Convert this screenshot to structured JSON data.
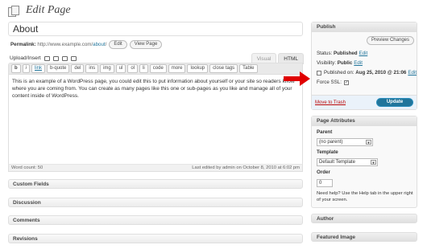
{
  "header": {
    "title": "Edit Page"
  },
  "title_field": {
    "value": "About"
  },
  "permalink": {
    "label": "Permalink:",
    "base": "http://www.example.com/",
    "slug": "about",
    "suffix": "/",
    "edit_label": "Edit",
    "view_label": "View Page"
  },
  "editor": {
    "upload_label": "Upload/Insert",
    "tabs": [
      {
        "label": "Visual"
      },
      {
        "label": "HTML"
      }
    ],
    "buttons": [
      "b",
      "i",
      "link",
      "b-quote",
      "del",
      "ins",
      "img",
      "ul",
      "ol",
      "li",
      "code",
      "more",
      "lookup",
      "close tags",
      "Table"
    ],
    "content": "This is an example of a WordPress page, you could edit this to put information about yourself or your site so readers know where you are coming from. You can create as many pages like this one or sub-pages as you like and manage all of your content inside of WordPress.",
    "word_count": "Word count: 50",
    "last_edited": "Last edited by admin on October 8, 2010 at 6:02 pm"
  },
  "boxes": {
    "custom_fields": "Custom Fields",
    "discussion": "Discussion",
    "comments": "Comments",
    "revisions": "Revisions"
  },
  "publish": {
    "title": "Publish",
    "preview_label": "Preview Changes",
    "status_label": "Status:",
    "status_value": "Published",
    "visibility_label": "Visibility:",
    "visibility_value": "Public",
    "published_label": "Published on:",
    "published_value": "Aug 25, 2010 @ 21:06",
    "edit_label": "Edit",
    "force_ssl_label": "Force SSL:",
    "force_ssl_mark": "✓",
    "trash_label": "Move to Trash",
    "update_label": "Update"
  },
  "attributes": {
    "title": "Page Attributes",
    "parent_label": "Parent",
    "parent_value": "(no parent)",
    "template_label": "Template",
    "template_value": "Default Template",
    "order_label": "Order",
    "order_value": "0",
    "help": "Need help? Use the Help tab in the upper right of your screen."
  },
  "sidebar_boxes": {
    "author": "Author",
    "featured_image": "Featured Image"
  },
  "colors": {
    "accent": "#21759b",
    "arrow": "#e00000",
    "trash": "#bc0b0b"
  }
}
